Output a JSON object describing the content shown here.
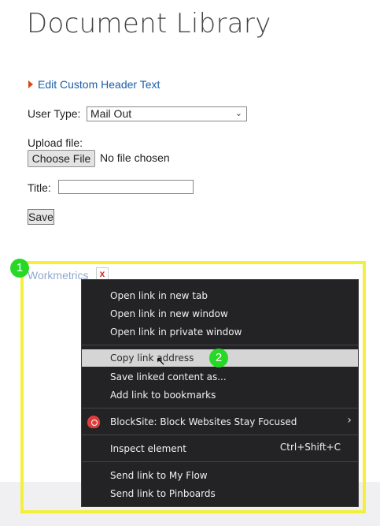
{
  "page": {
    "title": "Document Library",
    "edit_header_link": "Edit Custom Header Text"
  },
  "form": {
    "user_type_label": "User Type:",
    "user_type_value": "Mail Out",
    "upload_label": "Upload file:",
    "choose_file": "Choose File",
    "no_file": "No file chosen",
    "title_label": "Title:",
    "title_value": "",
    "save": "Save"
  },
  "library_item": {
    "link_text": "Workmetrics",
    "delete_icon": "x"
  },
  "badges": [
    "1",
    "2"
  ],
  "context_menu": {
    "items": [
      {
        "label": "Open link in new tab"
      },
      {
        "label": "Open link in new window"
      },
      {
        "label": "Open link in private window"
      },
      {
        "label": "Copy link address",
        "highlighted": true
      },
      {
        "label": "Save linked content as..."
      },
      {
        "label": "Add link to bookmarks"
      },
      {
        "label": "BlockSite: Block Websites  Stay Focused",
        "icon": "shield-icon",
        "submenu": true
      },
      {
        "label": "Inspect element",
        "shortcut": "Ctrl+Shift+C"
      },
      {
        "label": "Send link to My Flow"
      },
      {
        "label": "Send link to Pinboards"
      }
    ]
  },
  "colors": {
    "highlight_box": "#f4f03a",
    "badge": "#27d826",
    "menu_bg": "#232325",
    "link": "#1a5fa8"
  }
}
